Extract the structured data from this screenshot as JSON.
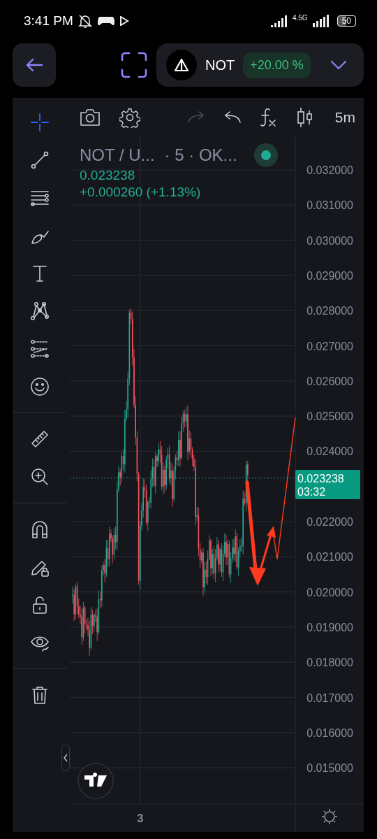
{
  "status_bar": {
    "time": "3:41 PM",
    "network": "4.5G",
    "battery": "50"
  },
  "header": {
    "symbol": "NOT",
    "change": "+20.00 %"
  },
  "toolbar": {
    "actions": [
      {
        "disabled": true
      },
      {
        "disabled": false
      }
    ],
    "interval": "5m"
  },
  "tool_groups": [
    {
      "tools": [
        {
          "selected": true
        },
        {
          "selected": false
        },
        {
          "selected": false
        },
        {
          "selected": false
        },
        {
          "selected": false
        },
        {
          "selected": false
        },
        {
          "selected": false
        },
        {
          "selected": false
        }
      ]
    },
    {
      "tools": [
        {
          "selected": false
        },
        {
          "selected": false
        }
      ]
    },
    {
      "tools": [
        {
          "selected": false
        },
        {
          "selected": false
        },
        {
          "selected": false
        },
        {
          "selected": false
        }
      ]
    },
    {
      "tools": [
        {
          "selected": false
        }
      ]
    }
  ],
  "legend": {
    "symbol": "NOT / U...",
    "details": "· 5 · OK...",
    "price": "0.023238",
    "change": "+0.000260 (+1.13%)"
  },
  "price_axis": [
    "0.032000",
    "0.031000",
    "0.030000",
    "0.029000",
    "0.028000",
    "0.027000",
    "0.026000",
    "0.025000",
    "0.024000",
    "0.022000",
    "0.021000",
    "0.020000",
    "0.019000",
    "0.018000",
    "0.017000",
    "0.016000",
    "0.015000"
  ],
  "last_price": {
    "value": "0.023238",
    "countdown": "03:32"
  },
  "time_axis": [
    "3"
  ]
}
